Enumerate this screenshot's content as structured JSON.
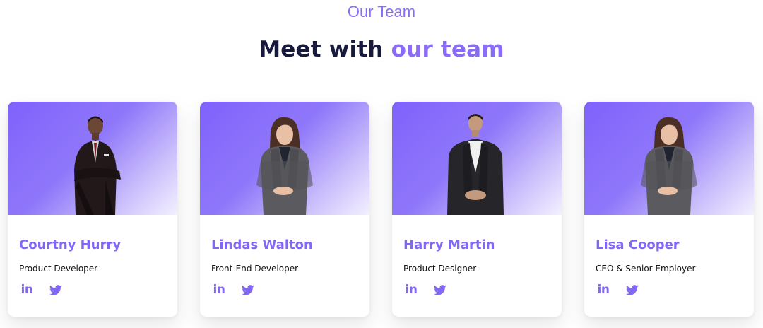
{
  "header": {
    "label": "Our Team",
    "title_prefix": "Meet with",
    "title_accent": "our team"
  },
  "members": [
    {
      "name": "Courtny Hurry",
      "role": "Product Developer",
      "photo": "man-in-dark-suit-arms-crossed"
    },
    {
      "name": "Lindas Walton",
      "role": "Front-End Developer",
      "photo": "woman-in-grey-suit"
    },
    {
      "name": "Harry Martin",
      "role": "Product Designer",
      "photo": "man-in-black-suit-white-shirt"
    },
    {
      "name": "Lisa Cooper",
      "role": "CEO & Senior Employer",
      "photo": "woman-in-grey-suit"
    }
  ],
  "social_icons": [
    "linkedin-icon",
    "twitter-icon"
  ],
  "social_labels": {
    "linkedin": "in"
  },
  "colors": {
    "accent": "#8a6cf8",
    "title": "#171a3d",
    "gradient_start": "#7f62fb",
    "gradient_end": "#f3f0ff"
  }
}
